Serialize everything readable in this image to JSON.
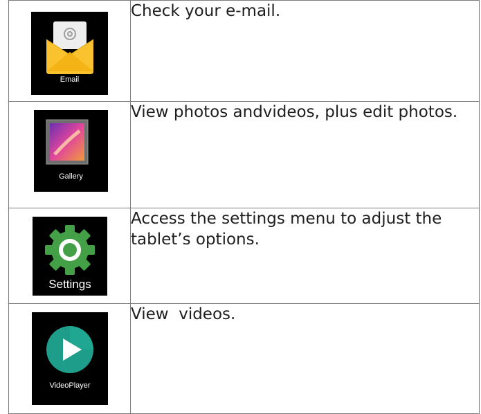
{
  "rows": [
    {
      "app_label": "Email",
      "icon": "email-icon",
      "description": "Check your e-mail."
    },
    {
      "app_label": "Gallery",
      "icon": "gallery-icon",
      "description": "View photos andvideos, plus edit photos."
    },
    {
      "app_label": "Settings",
      "icon": "settings-icon",
      "description": "Access the settings menu to adjust the tablet’s options."
    },
    {
      "app_label": "VideoPlayer",
      "icon": "video-player-icon",
      "description": "View  videos."
    }
  ],
  "colors": {
    "email_envelope": "#f9c22e",
    "email_paper": "#eeeeee",
    "settings_green": "#43a047",
    "video_teal": "#1e9e8a",
    "tile_bg": "#000000",
    "border": "#7a7a7a"
  }
}
